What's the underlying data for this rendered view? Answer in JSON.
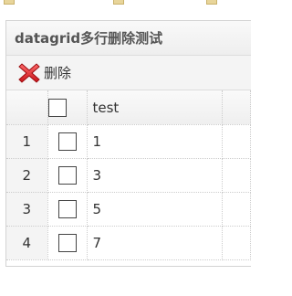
{
  "panel": {
    "title": "datagrid多行删除测试"
  },
  "toolbar": {
    "delete_label": "删除",
    "delete_icon": "delete-x-icon",
    "icon_color": "#e0242a"
  },
  "grid": {
    "columns": [
      "test"
    ],
    "rows": [
      {
        "rownum": "1",
        "test": "1"
      },
      {
        "rownum": "2",
        "test": "3"
      },
      {
        "rownum": "3",
        "test": "5"
      },
      {
        "rownum": "4",
        "test": "7"
      }
    ]
  }
}
